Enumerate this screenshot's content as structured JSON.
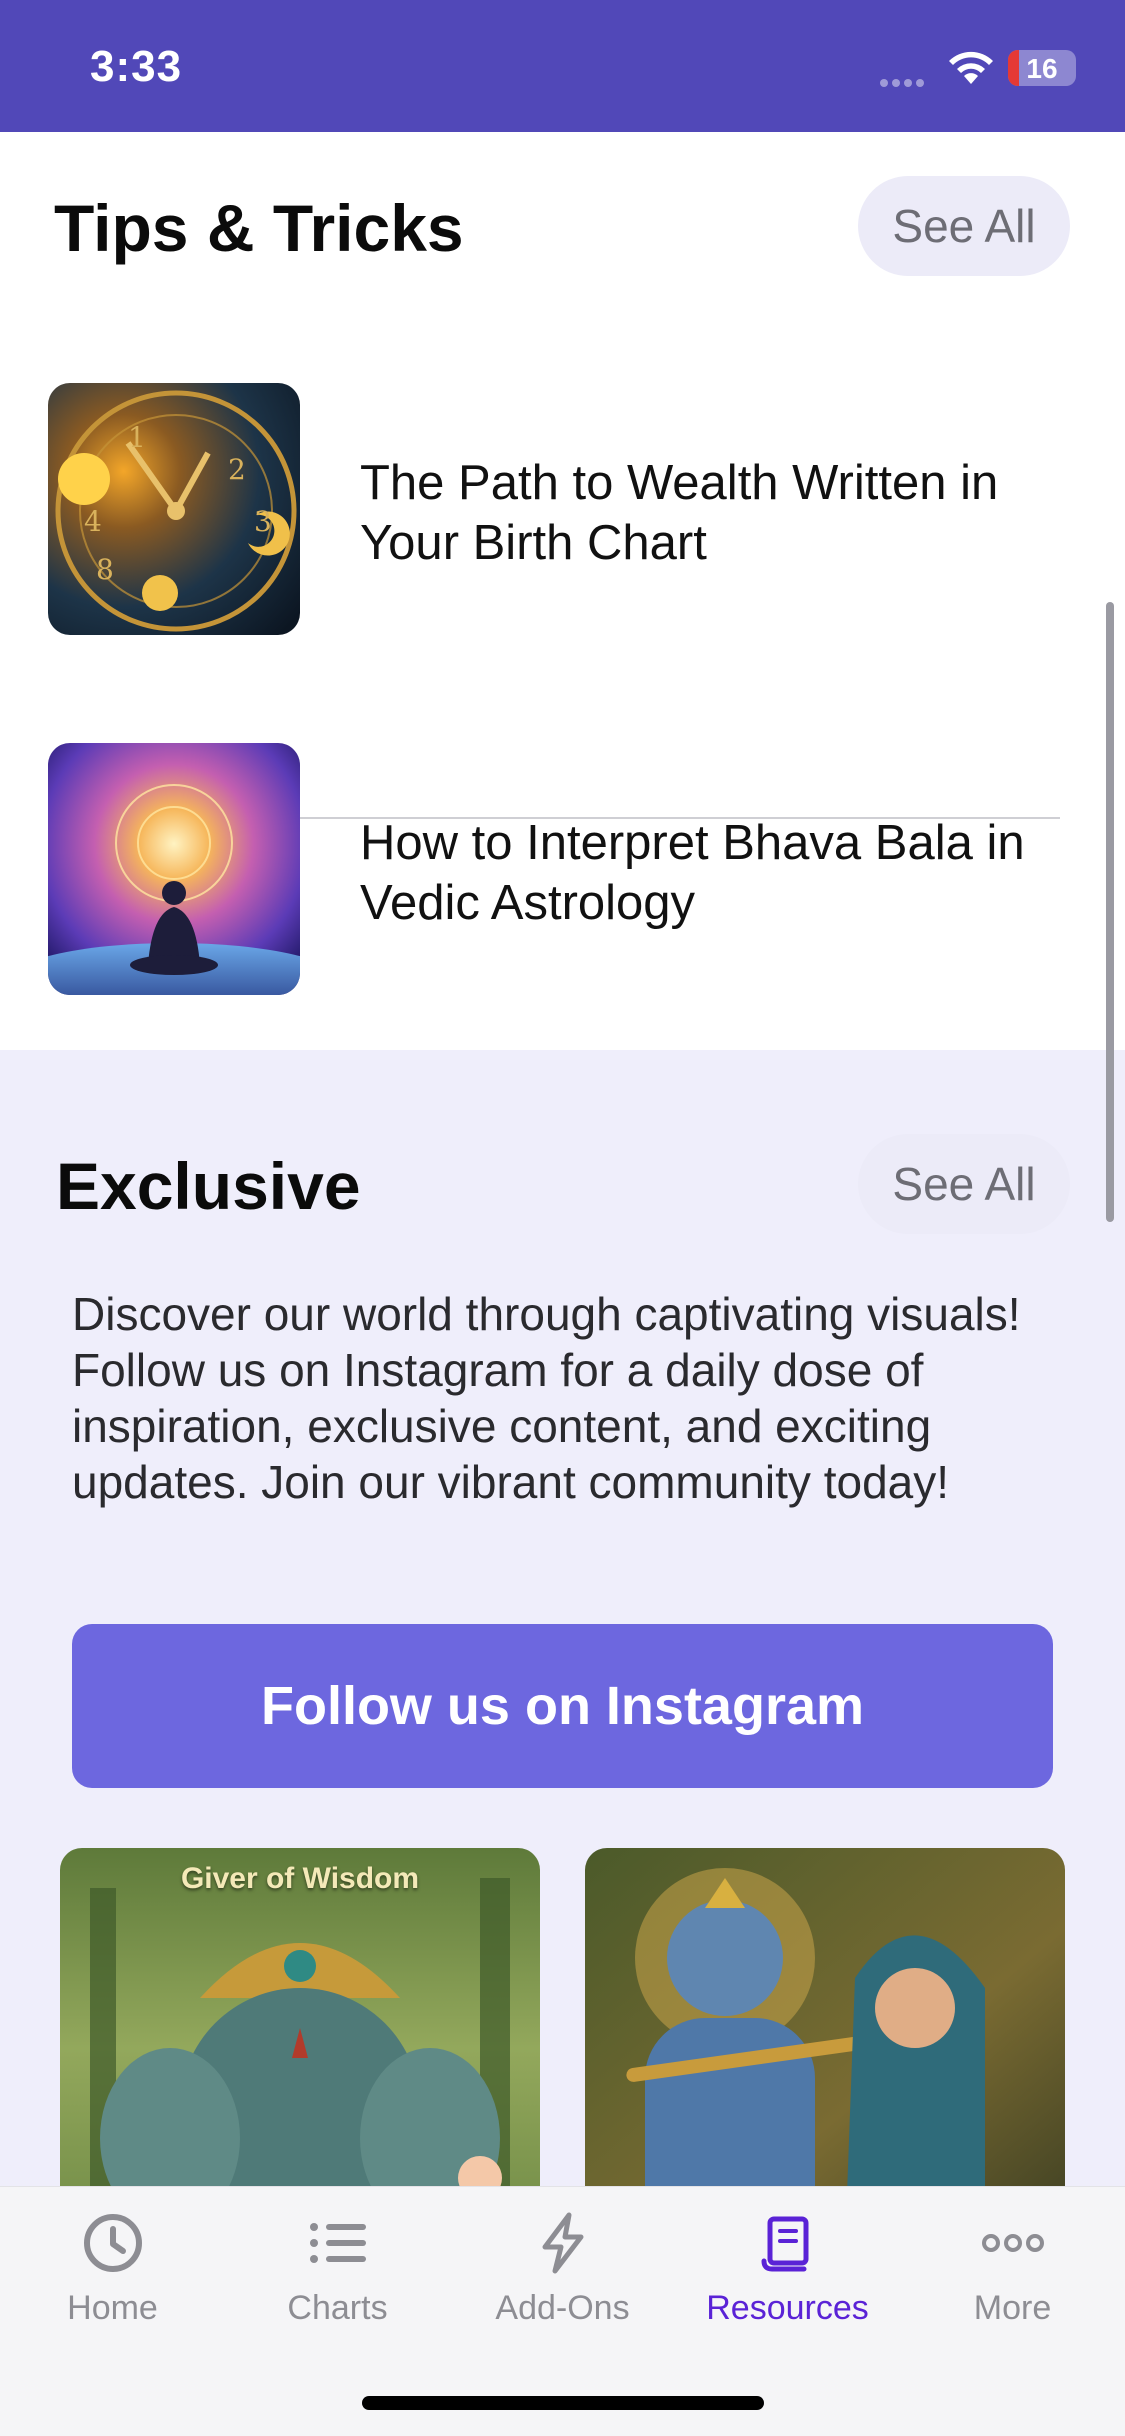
{
  "status_bar": {
    "time": "3:33",
    "battery_level": "16",
    "battery_fraction": 0.16,
    "colors": {
      "background": "#5148b8",
      "battery_low": "#e53935"
    }
  },
  "tips": {
    "title": "Tips & Tricks",
    "see_all_label": "See All",
    "items": [
      {
        "title": "The Path to Wealth Written in Your Birth Chart",
        "thumbnail": "clock-astrology-image"
      },
      {
        "title": "How to Interpret Bhava Bala in Vedic Astrology",
        "thumbnail": "meditation-cosmos-image"
      }
    ]
  },
  "exclusive": {
    "title": "Exclusive",
    "see_all_label": "See All",
    "description": "Discover our world through captivating visuals! Follow us on Instagram for a daily dose of inspiration, exclusive content, and exciting updates. Join our vibrant community today!",
    "follow_button_label": "Follow us on Instagram",
    "cards": [
      {
        "caption": "Giver of Wisdom",
        "image": "ganesha-image"
      },
      {
        "caption": "",
        "image": "krishna-radha-image"
      }
    ]
  },
  "tab_bar": {
    "active": "Resources",
    "accent_color": "#5a22d6",
    "items": [
      {
        "label": "Home",
        "icon": "clock-icon"
      },
      {
        "label": "Charts",
        "icon": "list-icon"
      },
      {
        "label": "Add-Ons",
        "icon": "bolt-icon"
      },
      {
        "label": "Resources",
        "icon": "document-icon"
      },
      {
        "label": "More",
        "icon": "ellipsis-icon"
      }
    ]
  }
}
